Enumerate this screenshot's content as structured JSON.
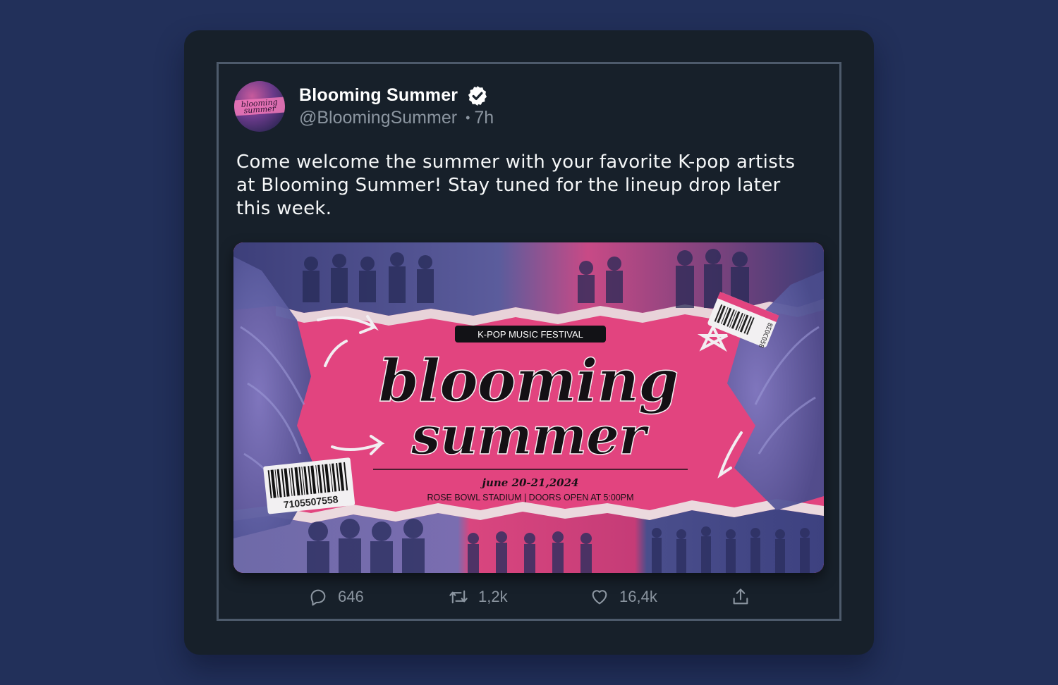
{
  "tweet": {
    "avatar_text": "blooming summer",
    "display_name": "Blooming Summer",
    "handle": "@BloomingSummer",
    "separator": "•",
    "time": "7h",
    "text": "Come welcome the summer with your favorite K-pop artists at Blooming Summer! Stay tuned for the lineup drop later this week."
  },
  "poster": {
    "badge": "K-POP MUSIC FESTIVAL",
    "title_line1": "blooming",
    "title_line2": "summer",
    "date": "june 20-21,2024",
    "venue": "ROSE BOWL STADIUM | DOORS OPEN AT 5:00PM",
    "barcode_number": "7105507558",
    "ticket_number": "8ΣOCO58"
  },
  "actions": {
    "replies": "646",
    "retweets": "1,2k",
    "likes": "16,4k"
  },
  "colors": {
    "page_bg": "#22305a",
    "card_bg": "#17202a",
    "border": "#4d5a6b",
    "muted_text": "#8b95a0",
    "poster_pink": "#e2447f",
    "photo_blue": "#4b4f8e"
  },
  "icons": [
    "verified-badge-icon",
    "reply-icon",
    "retweet-icon",
    "like-icon",
    "share-icon"
  ]
}
